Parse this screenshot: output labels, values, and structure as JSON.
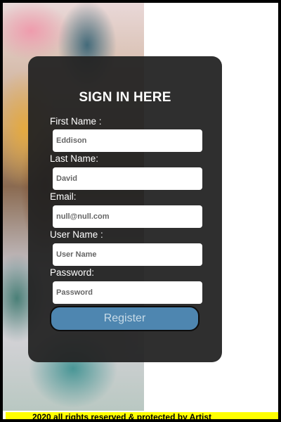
{
  "form": {
    "title": "SIGN IN HERE",
    "fields": [
      {
        "label": "First Name :",
        "value": "",
        "placeholder": "Eddison"
      },
      {
        "label": "Last Name:",
        "value": "",
        "placeholder": "David"
      },
      {
        "label": "Email:",
        "value": "",
        "placeholder": "null@null.com"
      },
      {
        "label": "User Name :",
        "value": "",
        "placeholder": "User Name"
      },
      {
        "label": "Password:",
        "value": "",
        "placeholder": "Password"
      }
    ],
    "register_label": "Register"
  },
  "footer": {
    "text": "2020 all rights reserved & protected by Artist"
  },
  "colors": {
    "card": "#222222",
    "button": "#4e86b0",
    "footer": "#ffff00"
  }
}
